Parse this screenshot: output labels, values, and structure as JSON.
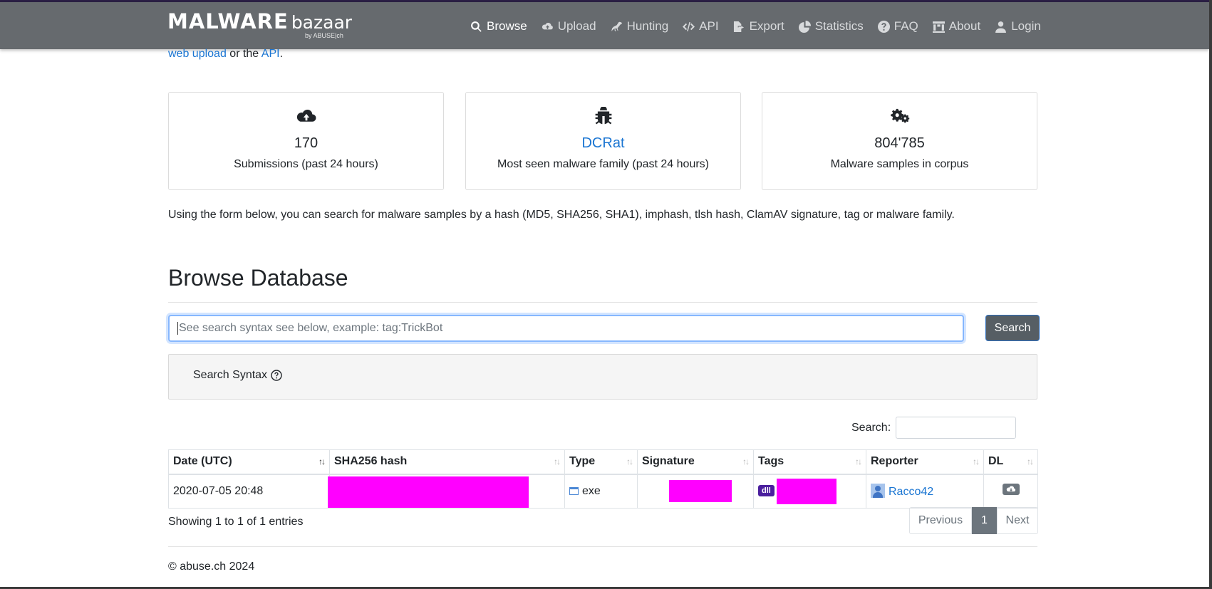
{
  "brand": {
    "main": "MALWARE",
    "light": "bazaar",
    "sub": "by ABUSE|ch"
  },
  "nav": [
    {
      "label": "Browse",
      "icon": "search-icon"
    },
    {
      "label": "Upload",
      "icon": "cloud-upload-icon"
    },
    {
      "label": "Hunting",
      "icon": "crow-icon"
    },
    {
      "label": "API",
      "icon": "code-icon"
    },
    {
      "label": "Export",
      "icon": "file-export-icon"
    },
    {
      "label": "Statistics",
      "icon": "pie-chart-icon"
    },
    {
      "label": "FAQ",
      "icon": "question-circle-icon"
    },
    {
      "label": "About",
      "icon": "landmark-icon"
    },
    {
      "label": "Login",
      "icon": "user-icon"
    }
  ],
  "intro": {
    "link1": "web upload",
    "mid": " or the ",
    "link2": "API",
    "end": "."
  },
  "cards": [
    {
      "icon": "cloud-upload-icon",
      "value": "170",
      "label": "Submissions (past 24 hours)"
    },
    {
      "icon": "bug-icon",
      "value": "DCRat",
      "label": "Most seen malware family (past 24 hours)"
    },
    {
      "icon": "cogs-icon",
      "value": "804'785",
      "label": "Malware samples in corpus"
    }
  ],
  "description": "Using the form below, you can search for malware samples by a hash (MD5, SHA256, SHA1), imphash, tlsh hash, ClamAV signature, tag or malware family.",
  "browse": {
    "title": "Browse Database",
    "search_placeholder": "See search syntax see below, example: tag:TrickBot",
    "search_button": "Search",
    "syntax_label": "Search Syntax"
  },
  "table": {
    "search_label": "Search:",
    "headers": [
      "Date (UTC)",
      "SHA256 hash",
      "Type",
      "Signature",
      "Tags",
      "Reporter",
      "DL"
    ],
    "rows": [
      {
        "date": "2020-07-05 20:48",
        "type": "exe",
        "tag": "dll",
        "reporter": "Racco42"
      }
    ],
    "showing": "Showing 1 to 1 of 1 entries",
    "pager": {
      "prev": "Previous",
      "current": "1",
      "next": "Next"
    }
  },
  "footer": "© abuse.ch 2024",
  "colors": {
    "navbar": "#666a6e",
    "link": "#1a75d2",
    "redaction": "#ff00ff",
    "tag_badge": "#4b1f9e"
  }
}
